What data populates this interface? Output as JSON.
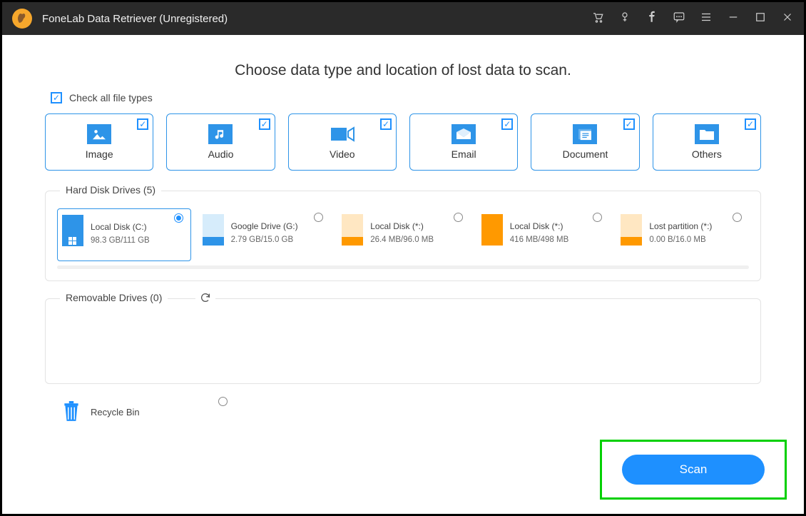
{
  "titlebar": {
    "title": "FoneLab Data Retriever (Unregistered)"
  },
  "heading": "Choose data type and location of lost data to scan.",
  "checkall_label": "Check all file types",
  "types": [
    {
      "label": "Image"
    },
    {
      "label": "Audio"
    },
    {
      "label": "Video"
    },
    {
      "label": "Email"
    },
    {
      "label": "Document"
    },
    {
      "label": "Others"
    }
  ],
  "hdd_section_title": "Hard Disk Drives (5)",
  "removable_section_title": "Removable Drives (0)",
  "drives": [
    {
      "name": "Local Disk (C:)",
      "size": "98.3 GB/111 GB",
      "top": "#2e94e8",
      "bot": "#2e94e8",
      "selected": true,
      "win": true
    },
    {
      "name": "Google Drive (G:)",
      "size": "2.79 GB/15.0 GB",
      "top": "#d6ecfb",
      "bot": "#2e94e8",
      "selected": false,
      "win": false
    },
    {
      "name": "Local Disk (*:)",
      "size": "26.4 MB/96.0 MB",
      "top": "#ffe7c2",
      "bot": "#ff9900",
      "selected": false,
      "win": false
    },
    {
      "name": "Local Disk (*:)",
      "size": "416 MB/498 MB",
      "top": "#ff9900",
      "bot": "#ff9900",
      "selected": false,
      "win": false
    },
    {
      "name": "Lost partition (*:)",
      "size": "0.00  B/16.0 MB",
      "top": "#ffe7c2",
      "bot": "#ff9900",
      "selected": false,
      "win": false
    }
  ],
  "recycle_label": "Recycle Bin",
  "scan_label": "Scan"
}
